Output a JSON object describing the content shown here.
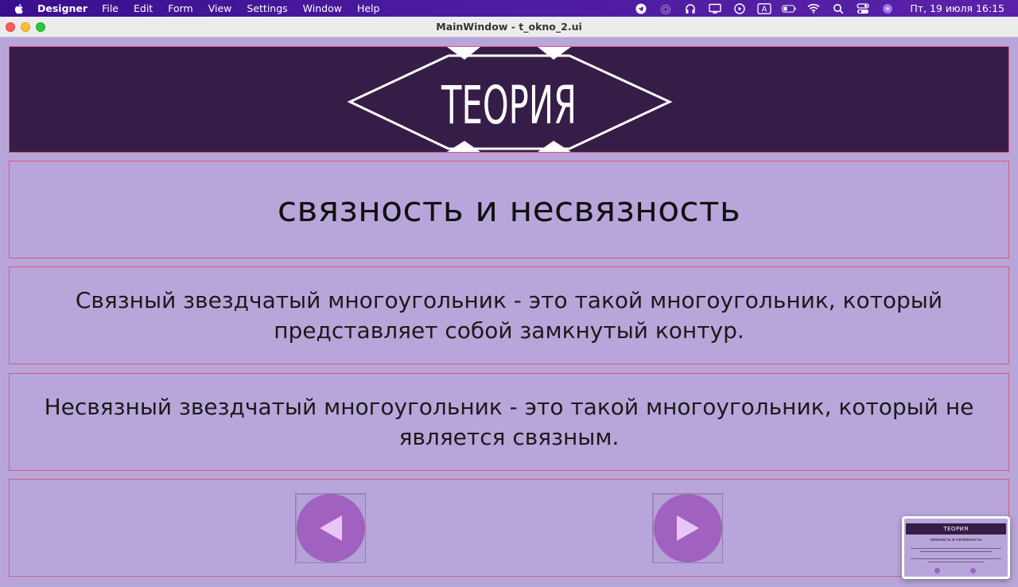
{
  "menubar": {
    "app_name": "Designer",
    "items": [
      "File",
      "Edit",
      "Form",
      "View",
      "Settings",
      "Window",
      "Help"
    ],
    "clock": "Пт, 19 июля  16:15",
    "input_source": "A"
  },
  "window": {
    "title": "MainWindow - t_okno_2.ui"
  },
  "banner": {
    "logo_text": "ТЕОРИЯ"
  },
  "heading": "связность и несвязность",
  "paragraphs": {
    "p1": "Связный звездчатый многоугольник - это такой многоугольник, который представляет собой замкнутый контур.",
    "p2": "Несвязный звездчатый многоугольник - это такой многоугольник, который не является связным."
  },
  "nav": {
    "prev_icon": "triangle-left-icon",
    "next_icon": "triangle-right-icon"
  },
  "thumbnail": {
    "logo_text": "ТЕОРИЯ",
    "heading": "связность и несвязность"
  },
  "colors": {
    "window_bg": "#b8a6da",
    "banner_bg": "#361d47",
    "panel_border": "#d9587a",
    "button_circle": "#a061c0",
    "button_arrow": "#e9c5f5"
  }
}
